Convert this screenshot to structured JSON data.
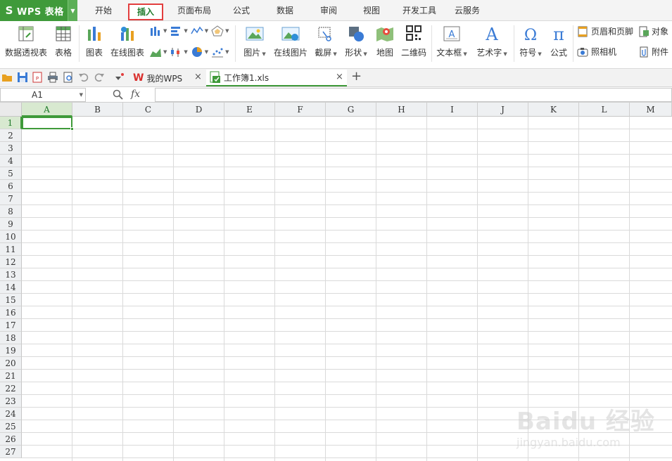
{
  "app": {
    "title": "WPS 表格",
    "logo": "S",
    "accent": "#3f9a3a"
  },
  "menu_tabs": [
    "开始",
    "插入",
    "页面布局",
    "公式",
    "数据",
    "审阅",
    "视图",
    "开发工具",
    "云服务"
  ],
  "active_tab": "插入",
  "ribbon": {
    "pivot": "数据透视表",
    "table": "表格",
    "chart": "图表",
    "online_chart": "在线图表",
    "picture": "图片",
    "online_picture": "在线图片",
    "screenshot": "截屏",
    "shape": "形状",
    "map": "地图",
    "qrcode": "二维码",
    "textbox": "文本框",
    "arttext": "艺术字",
    "symbol": "符号",
    "formula": "公式",
    "header_footer": "页眉和页脚",
    "object": "对象",
    "camera": "照相机",
    "attachment": "附件"
  },
  "doc_tabs": [
    {
      "label": "我的WPS"
    },
    {
      "label": "工作簿1.xls"
    }
  ],
  "formula_bar": {
    "cell_ref": "A1",
    "fx": "fx",
    "value": ""
  },
  "columns": [
    "A",
    "B",
    "C",
    "D",
    "E",
    "F",
    "G",
    "H",
    "I",
    "J",
    "K",
    "L",
    "M"
  ],
  "rows": [
    "1",
    "2",
    "3",
    "4",
    "5",
    "6",
    "7",
    "8",
    "9",
    "10",
    "11",
    "12",
    "13",
    "14",
    "15",
    "16",
    "17",
    "18",
    "19",
    "20",
    "21",
    "22",
    "23",
    "24",
    "25",
    "26",
    "27"
  ],
  "watermark": {
    "main": "Baidu 经验",
    "sub": "jingyan.baidu.com"
  }
}
